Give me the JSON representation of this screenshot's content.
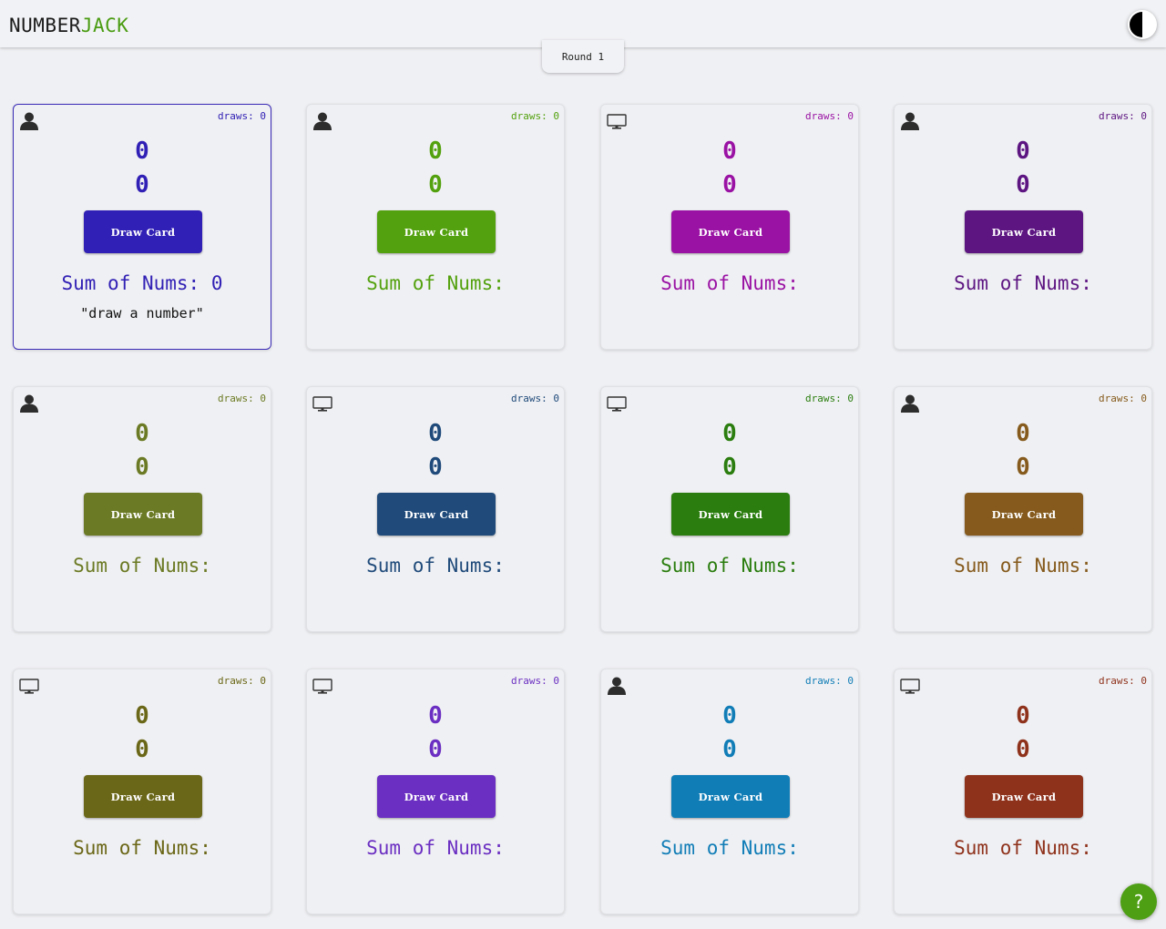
{
  "header": {
    "logo_part1": "NUMBER",
    "logo_part2": "JACK",
    "logo_color1": "#1a1a1a",
    "logo_color2": "#4a9c12"
  },
  "round_label": "Round 1",
  "help_label": "?",
  "draw_label": "Draw Card",
  "draws_label": "draws: 0",
  "sum_label": "Sum of Nums:",
  "players": [
    {
      "type": "human-icon",
      "color": "#3120b5",
      "num1": "0",
      "num2": "0",
      "sum": "Sum of Nums: 0",
      "message": "\"draw a number\"",
      "active": true
    },
    {
      "type": "human-icon",
      "color": "#53a10e",
      "num1": "0",
      "num2": "0",
      "sum": "Sum of Nums:",
      "message": ""
    },
    {
      "type": "computer-icon",
      "color": "#9a12a4",
      "num1": "0",
      "num2": "0",
      "sum": "Sum of Nums:",
      "message": ""
    },
    {
      "type": "human-icon",
      "color": "#5d1582",
      "num1": "0",
      "num2": "0",
      "sum": "Sum of Nums:",
      "message": ""
    },
    {
      "type": "human-icon",
      "color": "#6b7a24",
      "num1": "0",
      "num2": "0",
      "sum": "Sum of Nums:",
      "message": ""
    },
    {
      "type": "computer-icon",
      "color": "#1f4a7a",
      "num1": "0",
      "num2": "0",
      "sum": "Sum of Nums:",
      "message": ""
    },
    {
      "type": "computer-icon",
      "color": "#2a7d0e",
      "num1": "0",
      "num2": "0",
      "sum": "Sum of Nums:",
      "message": ""
    },
    {
      "type": "human-icon",
      "color": "#855a1c",
      "num1": "0",
      "num2": "0",
      "sum": "Sum of Nums:",
      "message": ""
    },
    {
      "type": "computer-icon",
      "color": "#6b6718",
      "num1": "0",
      "num2": "0",
      "sum": "Sum of Nums:",
      "message": ""
    },
    {
      "type": "computer-icon",
      "color": "#6b2fc2",
      "num1": "0",
      "num2": "0",
      "sum": "Sum of Nums:",
      "message": ""
    },
    {
      "type": "human-icon",
      "color": "#117db7",
      "num1": "0",
      "num2": "0",
      "sum": "Sum of Nums:",
      "message": ""
    },
    {
      "type": "computer-icon",
      "color": "#8f321c",
      "num1": "0",
      "num2": "0",
      "sum": "Sum of Nums:",
      "message": ""
    }
  ]
}
